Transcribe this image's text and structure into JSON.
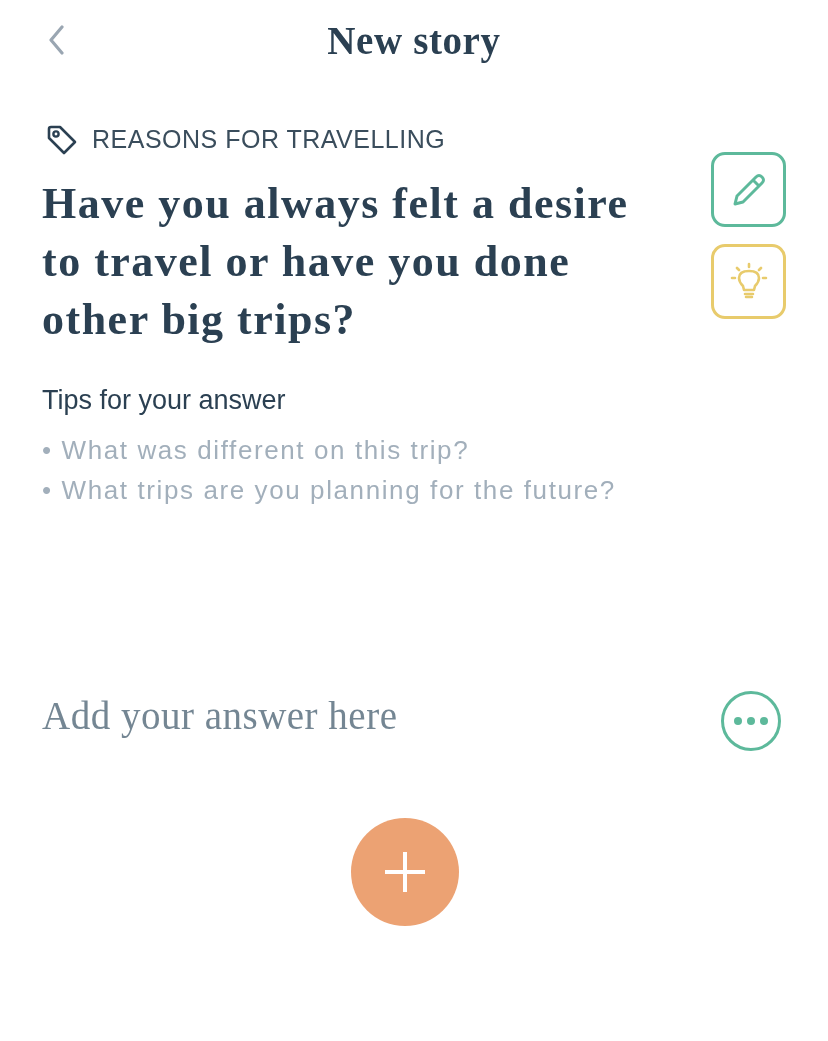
{
  "header": {
    "title": "New story"
  },
  "category": {
    "label": "REASONS FOR TRAVELLING"
  },
  "question": {
    "text": "Have you always felt a desire to travel or have you done other big trips?"
  },
  "side_buttons": [
    {
      "kind": "edit",
      "color": "#5db99b"
    },
    {
      "kind": "idea",
      "color": "#e8cb6c"
    }
  ],
  "tips": {
    "title": "Tips for your answer",
    "items": [
      "• What was different on this trip?",
      "• What trips are you planning for the future?"
    ]
  },
  "answer": {
    "placeholder": "Add your answer here"
  }
}
